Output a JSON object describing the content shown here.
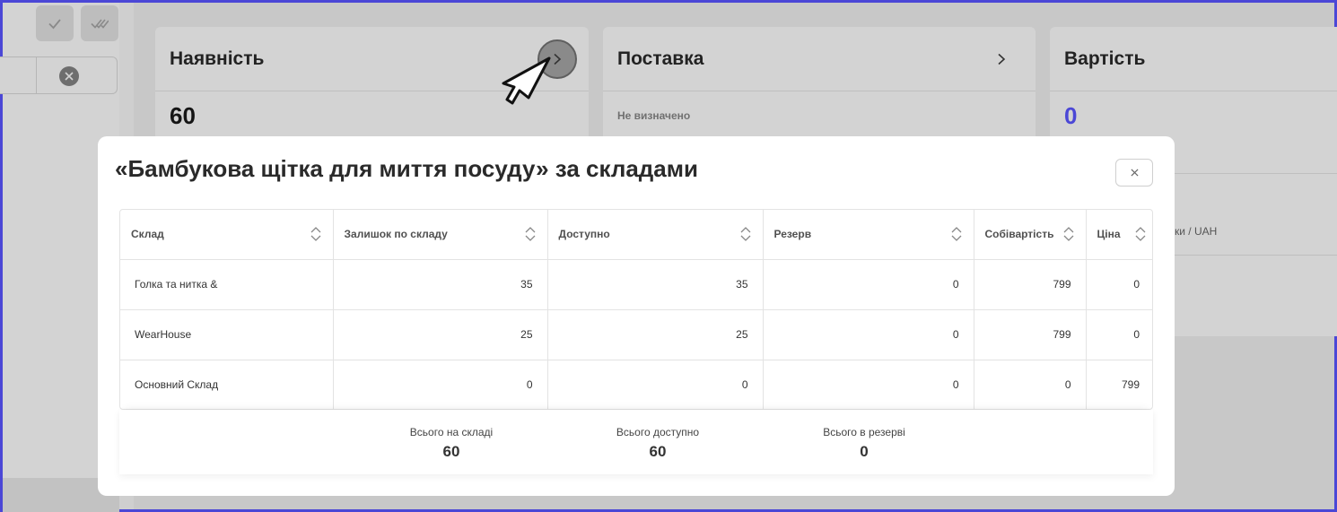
{
  "toolbar": {
    "check_icon": "check-icon",
    "double_check_icon": "double-check-icon"
  },
  "cards": [
    {
      "title": "Наявність",
      "value": "60"
    },
    {
      "title": "Поставка",
      "value": "Не визначено"
    },
    {
      "title": "Вартість",
      "value": "0",
      "sub": "ки / UAH",
      "value_color": "#4b47d6"
    }
  ],
  "modal": {
    "title": "«Бамбукова щітка для миття посуду» за складами",
    "close_label": "×",
    "columns": [
      "Склад",
      "Залишок по складу",
      "Доступно",
      "Резерв",
      "Собівартість",
      "Ціна"
    ],
    "rows": [
      [
        "Голка та нитка &",
        "35",
        "35",
        "0",
        "799",
        "0"
      ],
      [
        "WearHouse",
        "25",
        "25",
        "0",
        "799",
        "0"
      ],
      [
        "Основний Склад",
        "0",
        "0",
        "0",
        "0",
        "799"
      ]
    ],
    "totals": [
      {
        "label": "Всього на складі",
        "value": "60"
      },
      {
        "label": "Всього доступно",
        "value": "60"
      },
      {
        "label": "Всього в резерві",
        "value": "0"
      }
    ]
  }
}
